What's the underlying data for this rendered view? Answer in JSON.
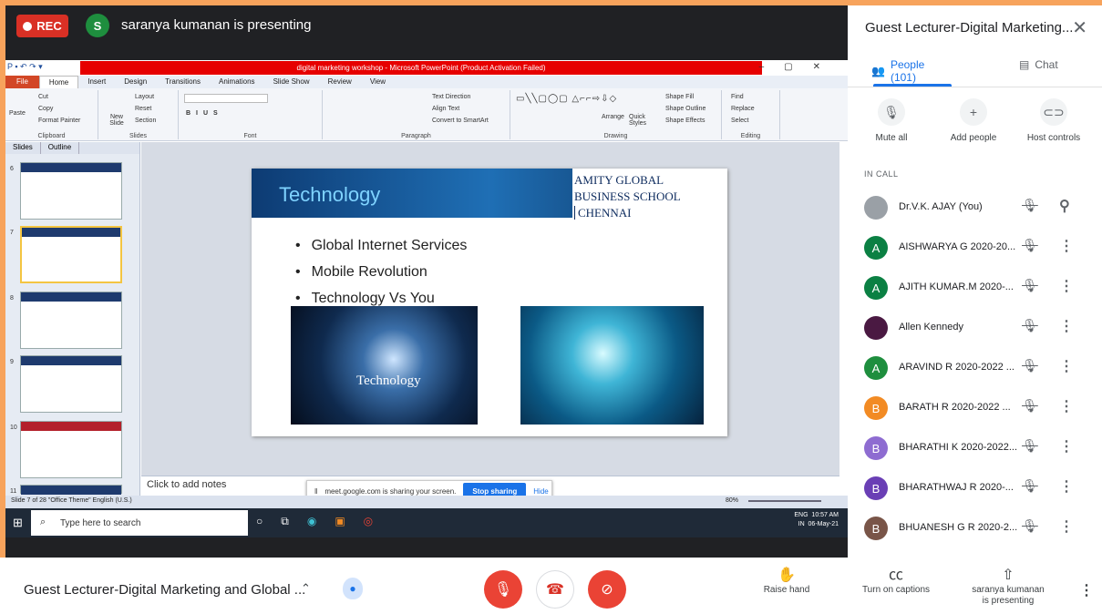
{
  "meet": {
    "rec_label": "REC",
    "presenter_initial": "S",
    "presenter_text": "saranya kumanan is presenting",
    "panel_title": "Guest Lecturer-Digital Marketing...",
    "tab_people": "People (101)",
    "tab_chat": "Chat",
    "host_buttons": [
      {
        "label": "Mute all",
        "icon": "mic-off-icon"
      },
      {
        "label": "Add people",
        "icon": "add-person-icon"
      },
      {
        "label": "Host controls",
        "icon": "toggle-icon"
      }
    ],
    "in_call_label": "IN CALL",
    "participants": [
      {
        "name": "Dr.V.K. AJAY (You)",
        "initial": "",
        "color": "#9aa0a6",
        "action": "pin-icon"
      },
      {
        "name": "AISHWARYA G 2020-20...",
        "initial": "A",
        "color": "#0b8043"
      },
      {
        "name": "AJITH KUMAR.M 2020-...",
        "initial": "A",
        "color": "#0b8043"
      },
      {
        "name": "Allen Kennedy",
        "initial": "",
        "color": "#4a1942"
      },
      {
        "name": "ARAVIND R 2020-2022 ...",
        "initial": "A",
        "color": "#1e8e3e"
      },
      {
        "name": "BARATH R 2020-2022 ...",
        "initial": "B",
        "color": "#f28b24"
      },
      {
        "name": "BHARATHI K 2020-2022...",
        "initial": "B",
        "color": "#8e6cd1"
      },
      {
        "name": "BHARATHWAJ R 2020-...",
        "initial": "B",
        "color": "#6a3fb5"
      },
      {
        "name": "BHUANESH G R 2020-2...",
        "initial": "B",
        "color": "#795548"
      }
    ],
    "meeting_name": "Guest Lecturer-Digital Marketing and Global ...",
    "raise_hand": "Raise hand",
    "captions": "Turn on captions",
    "presenting_line1": "saranya kumanan",
    "presenting_line2": "is presenting"
  },
  "ppt": {
    "window_title": "digital marketing workshop - Microsoft PowerPoint (Product Activation Failed)",
    "menu": [
      "File",
      "Home",
      "Insert",
      "Design",
      "Transitions",
      "Animations",
      "Slide Show",
      "Review",
      "View"
    ],
    "ribbon_groups": [
      "Clipboard",
      "Slides",
      "Font",
      "Paragraph",
      "Drawing",
      "Editing"
    ],
    "ribbon_items": {
      "paste": "Paste",
      "cut": "Cut",
      "copy": "Copy",
      "format_painter": "Format Painter",
      "new_slide": "New Slide",
      "layout": "Layout",
      "reset": "Reset",
      "section": "Section",
      "text_direction": "Text Direction",
      "align_text": "Align Text",
      "convert_smartart": "Convert to SmartArt",
      "arrange": "Arrange",
      "quick_styles": "Quick Styles",
      "shape_fill": "Shape Fill",
      "shape_outline": "Shape Outline",
      "shape_effects": "Shape Effects",
      "find": "Find",
      "replace": "Replace",
      "select": "Select"
    },
    "pane_tabs": [
      "Slides",
      "Outline"
    ],
    "thumbnails": [
      "6",
      "7",
      "8",
      "9",
      "10",
      "11"
    ],
    "slide_title": "Technology",
    "school_line1": "AMITY GLOBAL",
    "school_line2": "BUSINESS SCHOOL",
    "school_line3": "CHENNAI",
    "bullets": [
      "Global Internet Services",
      "Mobile Revolution",
      "Technology Vs You"
    ],
    "img1_caption": "Technology",
    "notes_placeholder": "Click to add notes",
    "status_left": "Slide 7 of 28   \"Office Theme\"   English (U.S.)",
    "zoom": "80%",
    "share_text": "meet.google.com is sharing your screen.",
    "stop_sharing": "Stop sharing",
    "hide": "Hide",
    "search_placeholder": "Type here to search",
    "tray_lang1": "ENG",
    "tray_lang2": "IN",
    "time": "10:57 AM",
    "date": "06-May-21"
  }
}
